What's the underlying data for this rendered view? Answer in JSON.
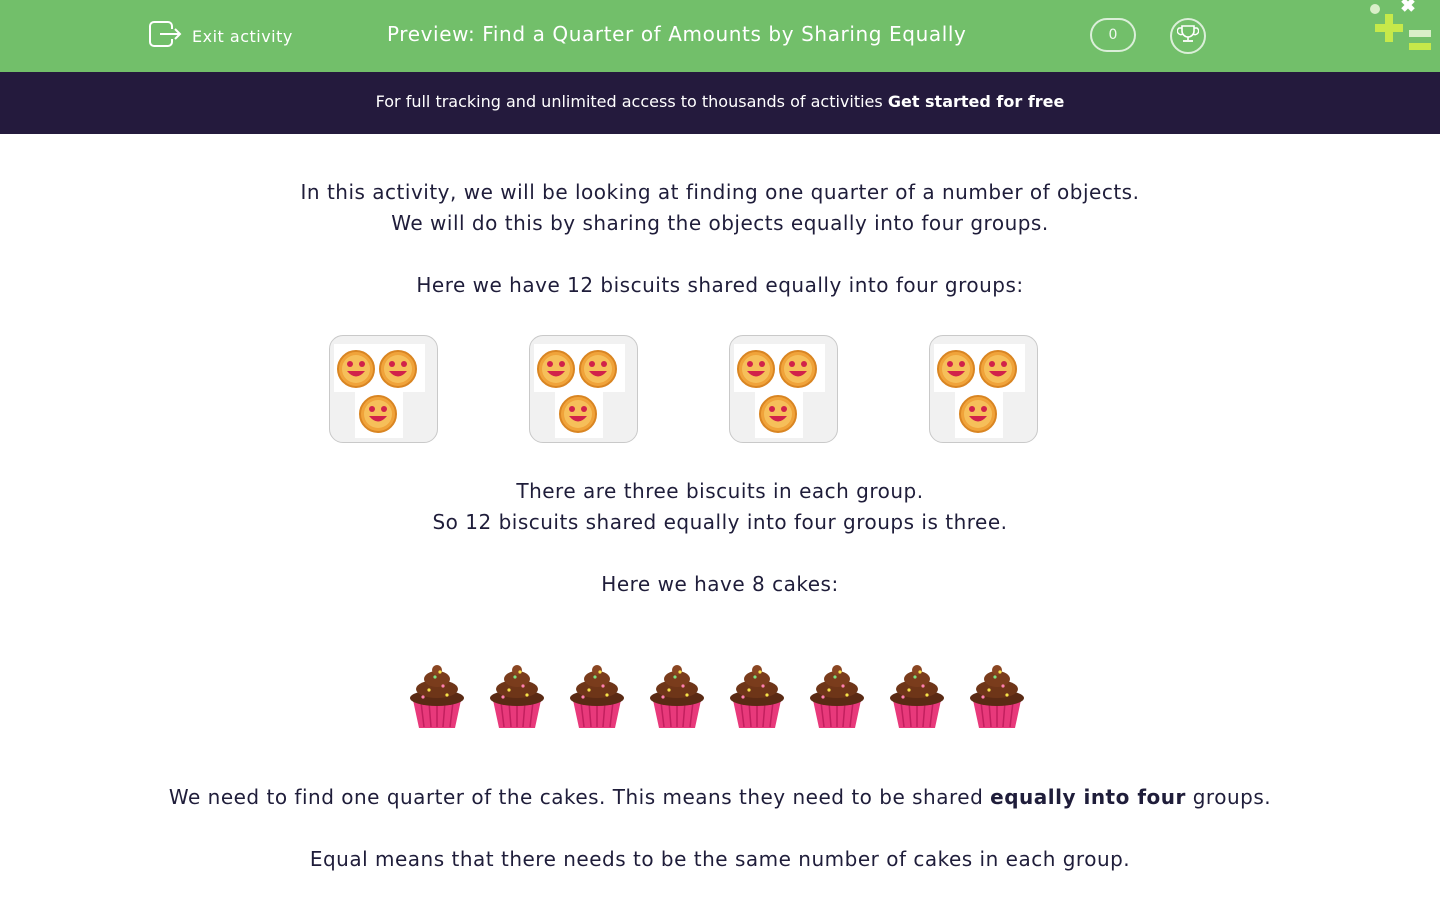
{
  "header": {
    "exit_label": "Exit activity",
    "title": "Preview: Find a Quarter of Amounts by Sharing Equally",
    "score": "0",
    "icons": {
      "exit": "exit-icon",
      "trophy": "trophy-icon",
      "logo": "brand-logo"
    }
  },
  "banner": {
    "text": "For full tracking and unlimited access to thousands of activities ",
    "cta": "Get started for free"
  },
  "content": {
    "intro_line1": "In this activity, we will be looking at finding one quarter of a number of objects.",
    "intro_line2": "We will do this by sharing the objects equally into four groups.",
    "biscuits_intro": "Here we have 12 biscuits shared equally into four groups:",
    "biscuit_groups": [
      3,
      3,
      3,
      3
    ],
    "result_line1": "There are three biscuits in each group.",
    "result_line2": "So 12 biscuits shared equally into four groups is three.",
    "cakes_intro": "Here we have 8 cakes:",
    "cake_count": 8,
    "need_pre": "We need to find one quarter of the cakes. This means they need to be shared ",
    "need_bold": "equally into four",
    "need_post": " groups.",
    "equal_text": "Equal means that there needs to be the same number of cakes in each group."
  },
  "colors": {
    "header_green": "#72bf6a",
    "banner_navy": "#241a3d",
    "text": "#1f1d3a",
    "cake_case": "#e8397b",
    "cake_frosting": "#5a2a14",
    "biscuit": "#f0a33a"
  }
}
